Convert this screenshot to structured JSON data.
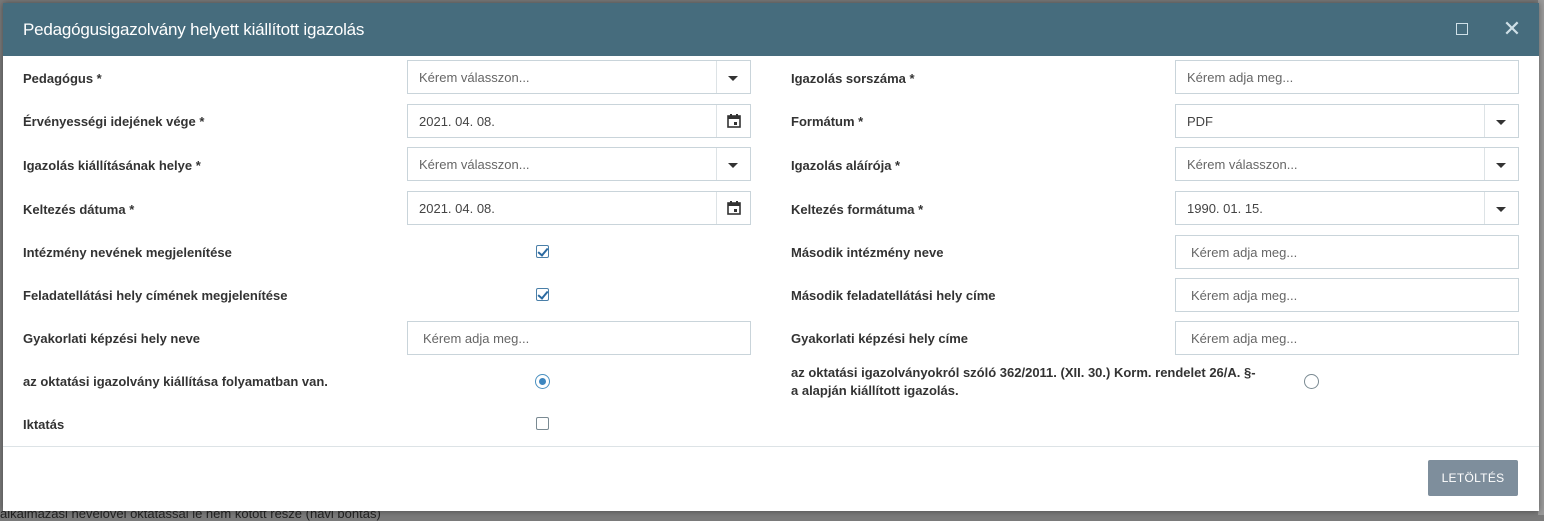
{
  "background": {
    "text": "alkalmazási nevelővel oktatással le nem kötött része (havi bontás)"
  },
  "dialog": {
    "title": "Pedagógusigazolvány helyett kiállított igazolás",
    "download_label": "LETÖLTÉS"
  },
  "left": {
    "pedagogus": {
      "label": "Pedagógus *",
      "placeholder": "Kérem válasszon..."
    },
    "ervenyesseg": {
      "label": "Érvényességi idejének vége *",
      "value": "2021. 04. 08."
    },
    "kiallitas_helye": {
      "label": "Igazolás kiállításának helye *",
      "placeholder": "Kérem válasszon..."
    },
    "keltezes_datuma": {
      "label": "Keltezés dátuma *",
      "value": "2021. 04. 08."
    },
    "intezmeny_nev": {
      "label": "Intézmény nevének megjelenítése",
      "checked": true
    },
    "feladatellatasi_cim": {
      "label": "Feladatellátási hely címének megjelenítése",
      "checked": true
    },
    "gyakorlati_nev": {
      "label": "Gyakorlati képzési hely neve",
      "placeholder": "Kérem adja meg..."
    },
    "folyamatban": {
      "label": "az oktatási igazolvány kiállítása folyamatban van.",
      "selected": true
    },
    "iktatas": {
      "label": "Iktatás",
      "checked": false
    }
  },
  "right": {
    "sorszam": {
      "label": "Igazolás sorszáma *",
      "placeholder": "Kérem adja meg..."
    },
    "formatum": {
      "label": "Formátum *",
      "value": "PDF"
    },
    "alairo": {
      "label": "Igazolás aláírója *",
      "placeholder": "Kérem válasszon..."
    },
    "keltezes_formatum": {
      "label": "Keltezés formátuma *",
      "value": "1990. 01. 15."
    },
    "masodik_intezmeny": {
      "label": "Második intézmény neve",
      "placeholder": "Kérem adja meg..."
    },
    "masodik_cim": {
      "label": "Második feladatellátási hely címe",
      "placeholder": "Kérem adja meg..."
    },
    "gyakorlati_cim": {
      "label": "Gyakorlati képzési hely címe",
      "placeholder": "Kérem adja meg..."
    },
    "korm_rendelet": {
      "label_line1": "az oktatási igazolványokról szóló 362/2011. (XII. 30.) Korm. rendelet 26/A. §-",
      "label_line2": "a alapján kiállított igazolás.",
      "selected": false
    }
  }
}
